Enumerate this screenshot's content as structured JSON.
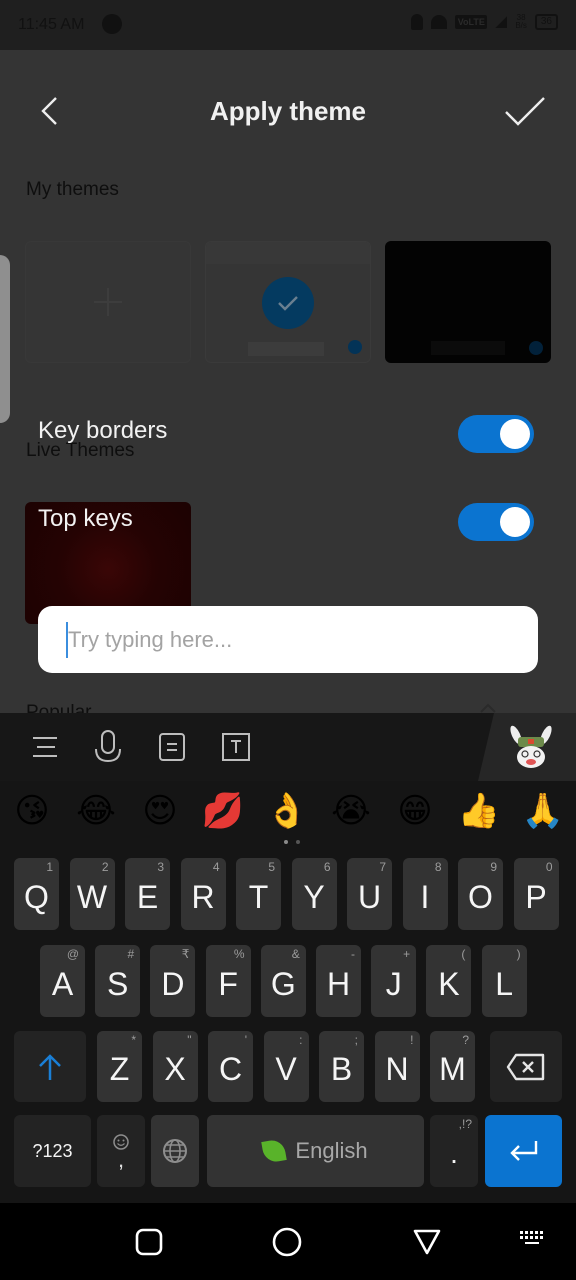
{
  "status_bar": {
    "time": "11:45 AM",
    "network": "VoLTE",
    "speed_top": "38",
    "speed_bottom": "B/s",
    "battery": "36"
  },
  "header": {
    "title": "Apply theme",
    "back_icon": "chevron-left-icon",
    "confirm_icon": "check-icon"
  },
  "sections": {
    "my_themes": "My themes",
    "live_themes": "Live Themes",
    "popular": "Popular"
  },
  "my_themes": [
    {
      "name": "add-theme",
      "icon": "plus-icon"
    },
    {
      "name": "default-theme",
      "selected": true
    },
    {
      "name": "black-theme",
      "selected": false
    }
  ],
  "settings": {
    "key_borders": {
      "label": "Key borders",
      "enabled": true
    },
    "top_keys": {
      "label": "Top keys",
      "enabled": true
    }
  },
  "try_input": {
    "value": "",
    "placeholder": "Try typing here..."
  },
  "keyboard": {
    "toolbar": [
      "menu-icon",
      "microphone-icon",
      "clipboard-icon",
      "text-edit-icon"
    ],
    "emojis": [
      "😘",
      "😂",
      "😍",
      "💋",
      "👌",
      "😭",
      "😁",
      "👍",
      "🙏"
    ],
    "row1": [
      {
        "key": "Q",
        "hint": "1"
      },
      {
        "key": "W",
        "hint": "2"
      },
      {
        "key": "E",
        "hint": "3"
      },
      {
        "key": "R",
        "hint": "4"
      },
      {
        "key": "T",
        "hint": "5"
      },
      {
        "key": "Y",
        "hint": "6"
      },
      {
        "key": "U",
        "hint": "7"
      },
      {
        "key": "I",
        "hint": "8"
      },
      {
        "key": "O",
        "hint": "9"
      },
      {
        "key": "P",
        "hint": "0"
      }
    ],
    "row2": [
      {
        "key": "A",
        "hint": "@"
      },
      {
        "key": "S",
        "hint": "#"
      },
      {
        "key": "D",
        "hint": "₹"
      },
      {
        "key": "F",
        "hint": "%"
      },
      {
        "key": "G",
        "hint": "&"
      },
      {
        "key": "H",
        "hint": "-"
      },
      {
        "key": "J",
        "hint": "+"
      },
      {
        "key": "K",
        "hint": "("
      },
      {
        "key": "L",
        "hint": ")"
      }
    ],
    "row3": [
      {
        "key": "Z",
        "hint": "*"
      },
      {
        "key": "X",
        "hint": "\""
      },
      {
        "key": "C",
        "hint": "'"
      },
      {
        "key": "V",
        "hint": ":"
      },
      {
        "key": "B",
        "hint": ";"
      },
      {
        "key": "N",
        "hint": "!"
      },
      {
        "key": "M",
        "hint": "?"
      }
    ],
    "symbols_key": "?123",
    "comma_key": ",",
    "space_label": "English",
    "period_key": ".",
    "period_hint": ",!?"
  },
  "colors": {
    "accent": "#0b74d0",
    "background": "#343434",
    "keyboard_bg": "#151515",
    "key_bg": "#333333"
  }
}
